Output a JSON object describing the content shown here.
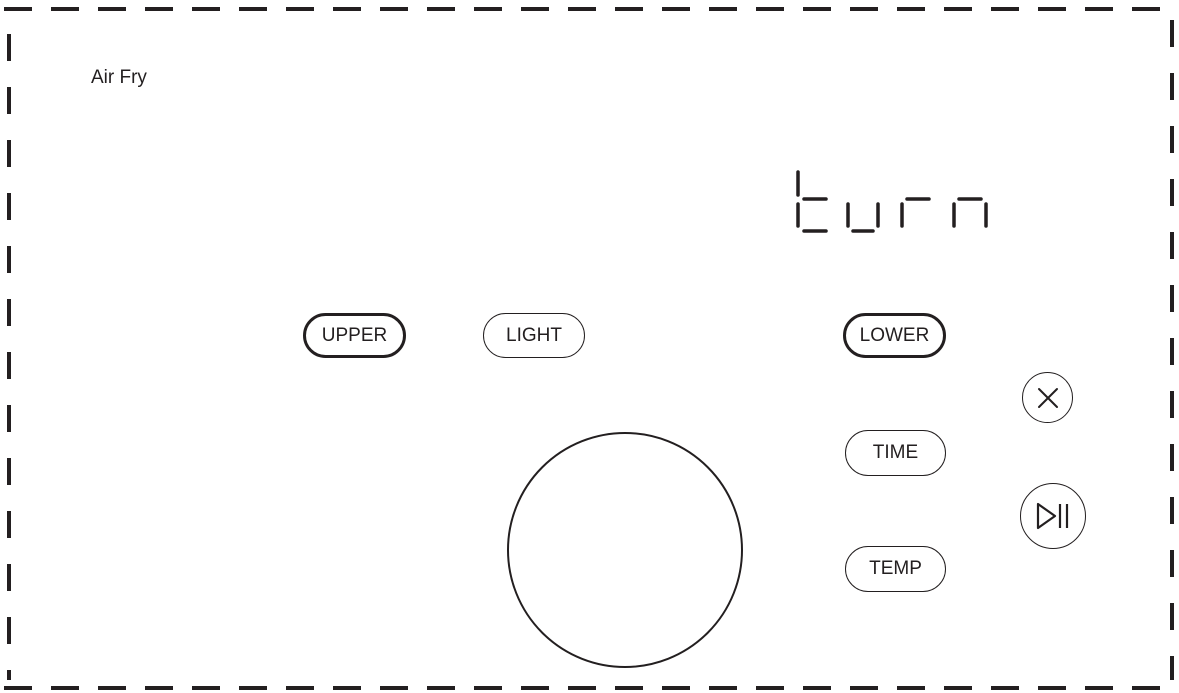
{
  "mode": {
    "label": "Air Fry"
  },
  "display": {
    "text": "turn"
  },
  "buttons": {
    "upper": "UPPER",
    "light": "LIGHT",
    "lower": "LOWER",
    "time": "TIME",
    "temp": "TEMP"
  },
  "icons": {
    "cancel": "cancel-x-icon",
    "start_pause": "play-pause-icon"
  },
  "colors": {
    "ink": "#231f20",
    "background": "#ffffff"
  }
}
